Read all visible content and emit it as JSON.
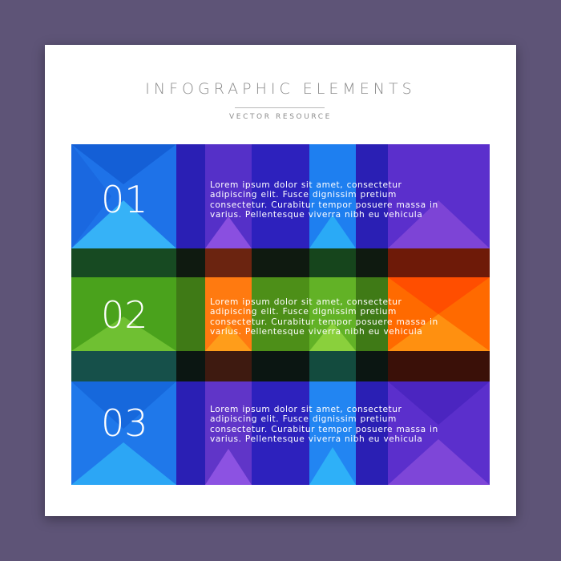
{
  "header": {
    "title": "INFOGRAPHIC ELEMENTS",
    "subtitle": "VECTOR RESOURCE"
  },
  "colors": {
    "background": "#5e5477",
    "card": "#ffffff",
    "blue": "#1b6fe6",
    "light_blue": "#29a8f5",
    "violet": "#4a2bc7",
    "purple": "#7a3fd0",
    "green": "#4a9a18",
    "orange": "#ff6a00",
    "dark_band": "#102a1a"
  },
  "rows": [
    {
      "number": "01",
      "text": "Lorem ipsum dolor sit amet, consectetur\nadipiscing elit. Fusce dignissim pretium\nconsectetur. Curabitur tempor posuere massa in\nvarius. Pellentesque viverra nibh eu vehicula"
    },
    {
      "number": "02",
      "text": "Lorem ipsum dolor sit amet, consectetur\nadipiscing elit. Fusce dignissim pretium\nconsectetur. Curabitur tempor posuere massa in\nvarius. Pellentesque viverra nibh eu vehicula"
    },
    {
      "number": "03",
      "text": "Lorem ipsum dolor sit amet, consectetur\nadipiscing elit. Fusce dignissim pretium\nconsectetur. Curabitur tempor posuere massa in\nvarius. Pellentesque viverra nibh eu vehicula"
    }
  ]
}
